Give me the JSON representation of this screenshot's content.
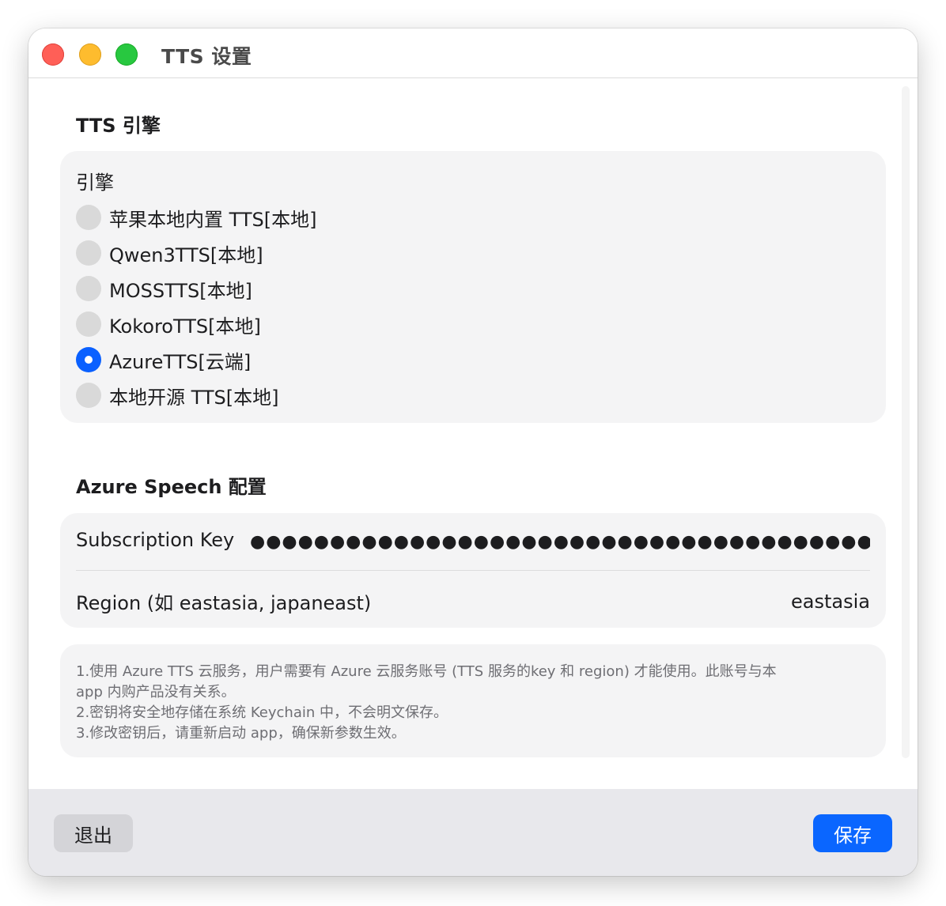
{
  "window": {
    "title": "TTS 设置"
  },
  "engine_section": {
    "title": "TTS 引擎",
    "heading": "引擎",
    "options": [
      {
        "label": "苹果本地内置 TTS[本地]",
        "selected": false
      },
      {
        "label": "Qwen3TTS[本地]",
        "selected": false
      },
      {
        "label": "MOSSTTS[本地]",
        "selected": false
      },
      {
        "label": "KokoroTTS[本地]",
        "selected": false
      },
      {
        "label": "AzureTTS[云端]",
        "selected": true
      },
      {
        "label": "本地开源 TTS[本地]",
        "selected": false
      }
    ]
  },
  "azure_section": {
    "title": "Azure Speech 配置",
    "key_label": "Subscription Key",
    "key_value": "●●●●●●●●●●●●●●●●●●●●●●●●●●●●●●●●●●●●●●●●●●●●●●●●●●●●●●●●●●●●●●●●●●●●●●●",
    "region_label": "Region (如 eastasia, japaneast)",
    "region_value": "eastasia"
  },
  "notes": [
    "1.使用 Azure TTS 云服务，用户需要有 Azure 云服务账号 (TTS 服务的key 和 region) 才能使用。此账号与本",
    "app 内购产品没有关系。",
    "2.密钥将安全地存储在系统 Keychain 中，不会明文保存。",
    "3.修改密钥后，请重新启动 app，确保新参数生效。"
  ],
  "footer": {
    "quit_label": "退出",
    "save_label": "保存"
  },
  "colors": {
    "accent": "#0a66ff",
    "close": "#ff5f57",
    "minimize": "#febc2e",
    "zoom": "#28c840"
  }
}
